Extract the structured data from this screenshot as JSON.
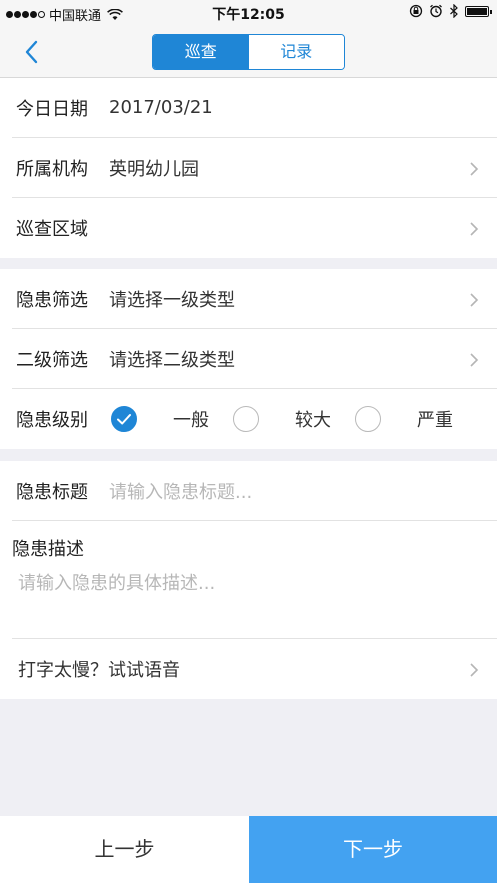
{
  "status_bar": {
    "carrier": "中国联通",
    "time": "下午12:05"
  },
  "nav": {
    "tabs": [
      {
        "label": "巡查",
        "active": true
      },
      {
        "label": "记录",
        "active": false
      }
    ],
    "accent_color": "#1f86d6"
  },
  "section1": {
    "date_label": "今日日期",
    "date_value": "2017/03/21",
    "org_label": "所属机构",
    "org_value": "英明幼儿园",
    "area_label": "巡查区域",
    "area_value": ""
  },
  "section2": {
    "filter1_label": "隐患筛选",
    "filter1_value": "请选择一级类型",
    "filter2_label": "二级筛选",
    "filter2_value": "请选择二级类型",
    "level_label": "隐患级别",
    "levels": [
      {
        "label": "一般",
        "selected": true
      },
      {
        "label": "较大",
        "selected": false
      },
      {
        "label": "严重",
        "selected": false
      }
    ]
  },
  "section3": {
    "title_label": "隐患标题",
    "title_placeholder": "请输入隐患标题...",
    "desc_label": "隐患描述",
    "desc_placeholder": "请输入隐患的具体描述...",
    "voice_label": "打字太慢？试试语音"
  },
  "footer": {
    "prev_label": "上一步",
    "next_label": "下一步",
    "next_color": "#43a2f1"
  }
}
